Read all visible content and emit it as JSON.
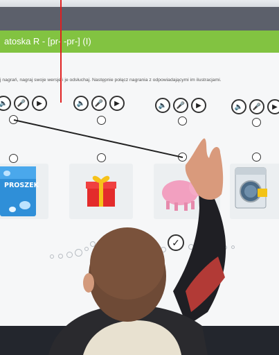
{
  "lesson": {
    "title": "atoska R - [pr- -pr-] (I)",
    "instruction": "j nagrań, nagraj swoje wersje i je odsłuchaj. Następnie połącz nagrania z odpowiadającymi im ilustracjami."
  },
  "controls": {
    "speaker_icon": "speaker-icon",
    "mic_icon": "microphone-icon",
    "play_icon": "play-icon"
  },
  "tiles": {
    "powder_label": "PROSZEK"
  },
  "icons": {
    "check": "check-icon"
  },
  "colors": {
    "green_bar": "#82c341",
    "red_line": "#e02020",
    "board": "#f6f7f8"
  }
}
